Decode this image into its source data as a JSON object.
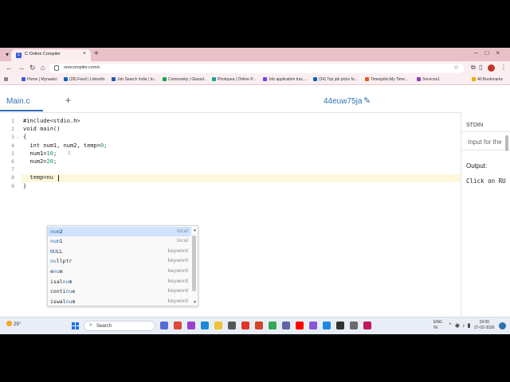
{
  "browser": {
    "tab_title": "C Online Compiler",
    "url": "onecompiler.com/c",
    "bookmarks": [
      {
        "label": "Home | Mynaukri",
        "color": "#3a5bd9"
      },
      {
        "label": "(28) Feed | LinkedIn",
        "color": "#0a66c2"
      },
      {
        "label": "Job Search India | In...",
        "color": "#2557a7"
      },
      {
        "label": "Community | Glassd...",
        "color": "#0caa41"
      },
      {
        "label": "Photopea | Online P...",
        "color": "#18a497"
      },
      {
        "label": "Job application trac...",
        "color": "#7b3fe4"
      },
      {
        "label": "(34) Top job picks fo...",
        "color": "#0a66c2"
      },
      {
        "label": "Timesjobs:My Time...",
        "color": "#e55a1c"
      },
      {
        "label": "Services1",
        "color": "#8e44ad"
      }
    ],
    "all_bookmarks": "All Bookmarks"
  },
  "app": {
    "file_tab": "Main.c",
    "add_symbol": "+",
    "project_name": "44euw75ja",
    "stdin_label": "STDIN",
    "stdin_placeholder": "Input for the",
    "output_label": "Output:",
    "output_text": "Click on RU"
  },
  "editor": {
    "line_numbers": [
      "1",
      "2",
      "3",
      "4",
      "5",
      "6",
      "7",
      "8",
      "9"
    ],
    "lines": [
      {
        "text": "#include<stdio.h>"
      },
      {
        "text": "void main()"
      },
      {
        "text": "{"
      },
      {
        "pre": "  int num1, num2, temp=",
        "num": "0",
        "post": ";"
      },
      {
        "pre": "  num1=",
        "num": "10",
        "post": ";"
      },
      {
        "pre": "  num2=",
        "num": "20",
        "post": ";"
      },
      {
        "text": ""
      },
      {
        "text": "  temp=nu"
      },
      {
        "text": "}"
      }
    ]
  },
  "autocomplete": {
    "items": [
      {
        "pre": "",
        "match": "num",
        "post": "2",
        "kind": "local"
      },
      {
        "pre": "",
        "match": "num",
        "post": "1",
        "kind": "local"
      },
      {
        "pre": "",
        "match": "NU",
        "post": "LL",
        "kind": "keyword"
      },
      {
        "pre": "",
        "match": "nu",
        "post": "llptr",
        "kind": "keyword"
      },
      {
        "pre": "e",
        "match": "nu",
        "post": "m",
        "kind": "keyword"
      },
      {
        "pre": "isal",
        "match": "nu",
        "post": "m",
        "kind": "keyword"
      },
      {
        "pre": "conti",
        "match": "nu",
        "post": "e",
        "kind": "keyword"
      },
      {
        "pre": "iswal",
        "match": "nu",
        "post": "m",
        "kind": "keyword"
      }
    ]
  },
  "taskbar": {
    "weather": "29°",
    "search_label": "Search",
    "lang_1": "ENG",
    "lang_2": "IN",
    "time": "19:00",
    "date": "27-02-2026"
  }
}
